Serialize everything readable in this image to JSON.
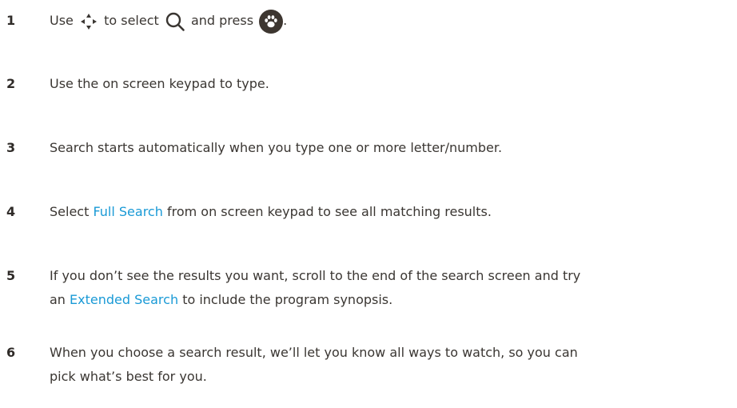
{
  "steps": [
    {
      "number": "1",
      "parts": {
        "use": "Use",
        "to_select": "to select",
        "and_press": "and press",
        "period": "."
      },
      "icons": [
        "dpad-arrows-icon",
        "search-icon",
        "paw-button-icon"
      ]
    },
    {
      "number": "2",
      "text": "Use the on screen keypad to type."
    },
    {
      "number": "3",
      "text": "Search starts automatically when you type one or more letter/number."
    },
    {
      "number": "4",
      "before": "Select",
      "link": "Full Search",
      "after": "from on screen keypad to see all matching results."
    },
    {
      "number": "5",
      "line1": "If you don’t see the results you want, scroll to the end of the search screen and try",
      "line2_before": "an",
      "link": "Extended Search",
      "line2_after": "to include the program synopsis."
    },
    {
      "number": "6",
      "line1": "When you choose a search result, we’ll let you know all ways to watch, so you can",
      "line2": "pick what’s best for you."
    }
  ],
  "colors": {
    "text": "#3a3632",
    "number": "#2f2b28",
    "link": "#1a9ad6",
    "paw_button": "#3d3630"
  }
}
